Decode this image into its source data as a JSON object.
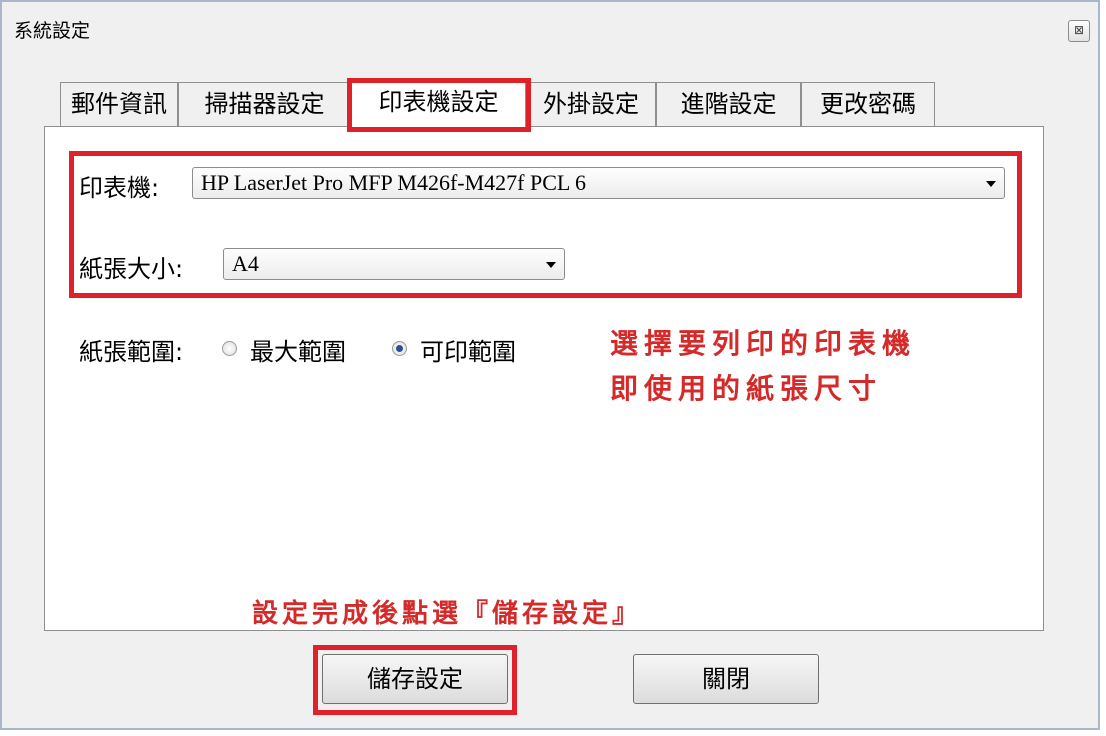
{
  "window": {
    "title": "系統設定",
    "close_label": "⊠"
  },
  "tabs": [
    {
      "label": "郵件資訊"
    },
    {
      "label": "掃描器設定"
    },
    {
      "label": "印表機設定",
      "active": true
    },
    {
      "label": "外掛設定"
    },
    {
      "label": "進階設定"
    },
    {
      "label": "更改密碼"
    }
  ],
  "printer": {
    "label": "印表機:",
    "value": "HP LaserJet Pro MFP M426f-M427f PCL 6"
  },
  "paper_size": {
    "label": "紙張大小:",
    "value": "A4"
  },
  "paper_range": {
    "label": "紙張範圍:",
    "options": [
      {
        "label": "最大範圍",
        "selected": false
      },
      {
        "label": "可印範圍",
        "selected": true
      }
    ]
  },
  "annotations": {
    "select_printer_line1": "選擇要列印的印表機",
    "select_printer_line2": "即使用的紙張尺寸",
    "save_hint": "設定完成後點選『儲存設定』"
  },
  "buttons": {
    "save": "儲存設定",
    "close": "關閉"
  },
  "colors": {
    "highlight": "#e0202a",
    "annotation": "#d42a2a"
  }
}
